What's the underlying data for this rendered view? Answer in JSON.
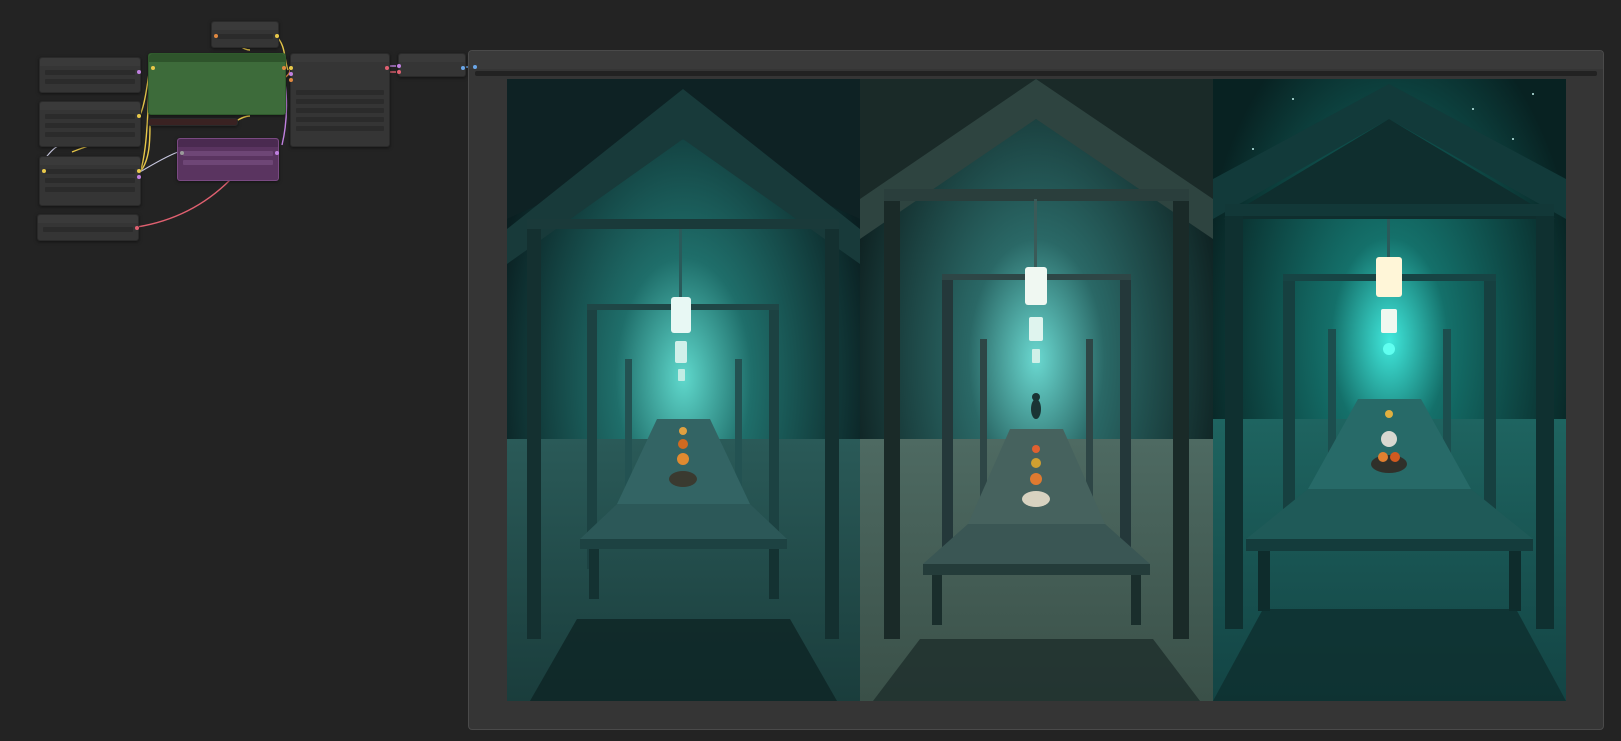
{
  "canvas": {
    "background_color": "#232323",
    "wire_colors": {
      "model": "#e8c84a",
      "conditioning": "#c080e0",
      "latent": "#e06070",
      "clip": "#e8c84a",
      "vae": "#e06070",
      "image": "#6aa6e8"
    }
  },
  "nodes": [
    {
      "id": "node-small-top",
      "kind": "generic"
    },
    {
      "id": "node-loader-1",
      "kind": "generic"
    },
    {
      "id": "node-loader-2",
      "kind": "generic"
    },
    {
      "id": "node-loader-3",
      "kind": "generic"
    },
    {
      "id": "node-loader-4",
      "kind": "generic"
    },
    {
      "id": "node-prompt-green",
      "kind": "positive-prompt",
      "color": "#3d6b3a"
    },
    {
      "id": "node-prompt-purple",
      "kind": "negative-prompt",
      "color": "#5a3460"
    },
    {
      "id": "node-sampler",
      "kind": "generic"
    },
    {
      "id": "node-decode",
      "kind": "generic"
    },
    {
      "id": "node-preview",
      "kind": "image-preview"
    }
  ],
  "preview": {
    "images": [
      {
        "name": "pavilion-lantern-table-1",
        "palette": "teal-night"
      },
      {
        "name": "pavilion-lantern-table-2",
        "palette": "teal-fog-figure"
      },
      {
        "name": "pavilion-lantern-table-3",
        "palette": "teal-starry"
      }
    ],
    "image_count": 3
  }
}
